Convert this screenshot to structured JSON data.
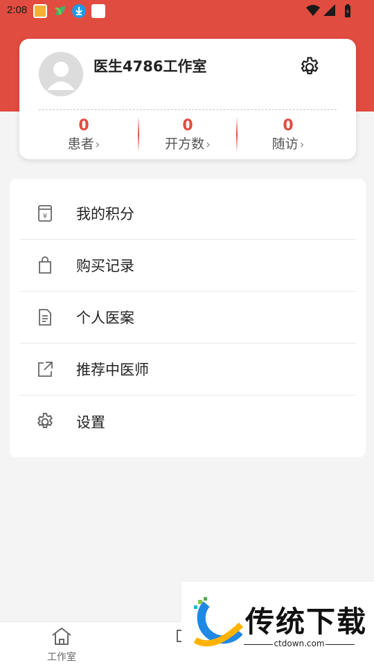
{
  "status_bar": {
    "time": "2:08"
  },
  "profile": {
    "studio_name": "医生4786工作室",
    "stats": [
      {
        "value": "0",
        "label": "患者"
      },
      {
        "value": "0",
        "label": "开方数"
      },
      {
        "value": "0",
        "label": "随访"
      }
    ]
  },
  "menu": {
    "items": [
      {
        "label": "我的积分",
        "icon": "points-icon"
      },
      {
        "label": "购买记录",
        "icon": "shopping-bag-icon"
      },
      {
        "label": "个人医案",
        "icon": "document-icon"
      },
      {
        "label": "推荐中医师",
        "icon": "share-icon"
      },
      {
        "label": "设置",
        "icon": "gear-icon"
      }
    ]
  },
  "bottom_nav": {
    "items": [
      {
        "label": "工作室",
        "icon": "home-icon"
      },
      {
        "label": "",
        "icon": "partial-icon"
      }
    ]
  },
  "watermark": {
    "title": "传统下载",
    "url": "ctdown.com"
  },
  "colors": {
    "accent": "#e04c3f",
    "background": "#f4f4f4"
  }
}
